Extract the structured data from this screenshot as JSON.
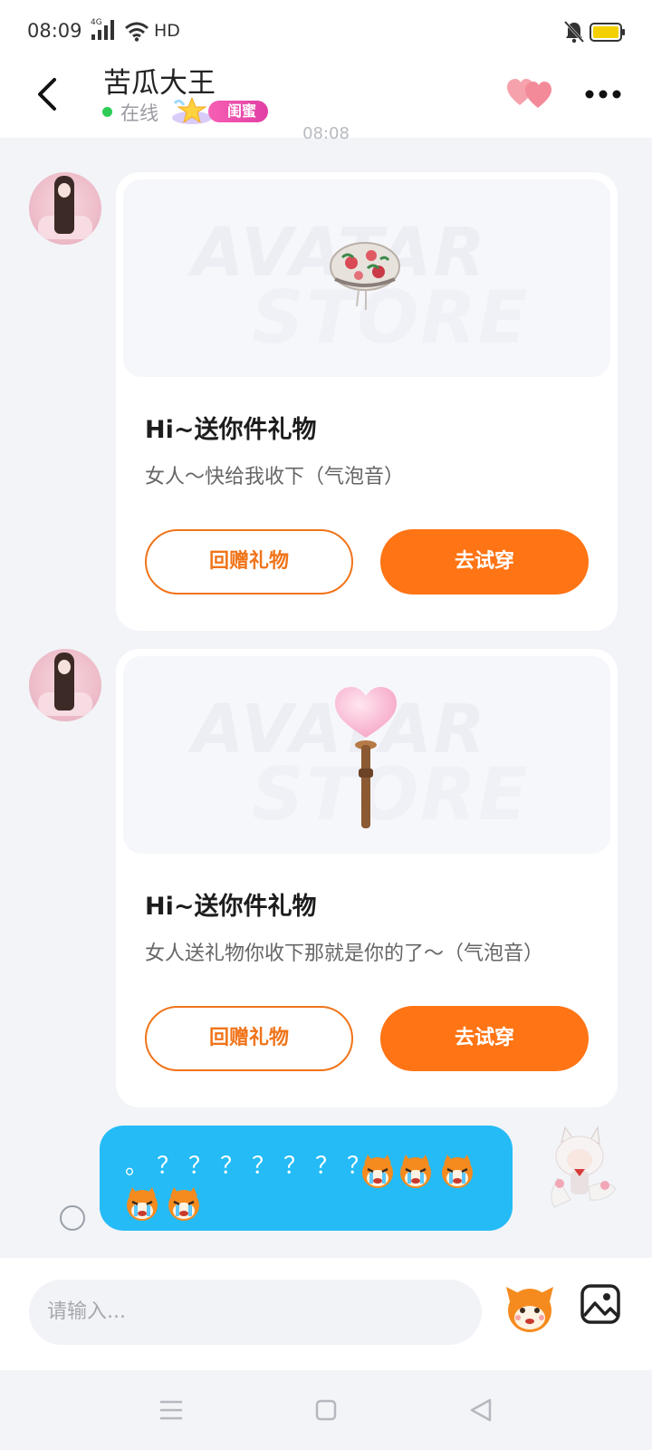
{
  "status_bar": {
    "time": "08:09",
    "network": "4G",
    "hd_label": "HD",
    "battery_color": "#f5d000"
  },
  "header": {
    "contact_name": "苦瓜大王",
    "online_status": "在线",
    "relation_badge": "闺蜜",
    "colors": {
      "online": "#2ecc55",
      "badge": "#e23ea3",
      "hearts": "#f49aa8"
    }
  },
  "timestamp_peek": "08:08",
  "messages": [
    {
      "sender": "contact",
      "type": "gift-card",
      "watermark_line1": "AVATAR",
      "watermark_line2": "STORE",
      "gift_icon": "floral-beret-icon",
      "title": "Hi~送你件礼物",
      "description": "女人～快给我收下（气泡音）",
      "secondary_button": "回赠礼物",
      "primary_button": "去试穿"
    },
    {
      "sender": "contact",
      "type": "gift-card",
      "watermark_line1": "AVATAR",
      "watermark_line2": "STORE",
      "gift_icon": "heart-wand-icon",
      "title": "Hi~送你件礼物",
      "description": "女人送礼物你收下那就是你的了～（气泡音）",
      "secondary_button": "回赠礼物",
      "primary_button": "去试穿"
    },
    {
      "sender": "me",
      "type": "text",
      "text": "。？？？？？？？",
      "emojis": [
        "crying-face-icon",
        "crying-face-icon",
        "crying-face-icon",
        "crying-face-icon",
        "crying-face-icon"
      ]
    }
  ],
  "composer": {
    "placeholder": "请输入..."
  },
  "theme": {
    "accent_orange": "#ff7414",
    "bubble_blue": "#24bbf6",
    "background": "#f2f4f8"
  }
}
